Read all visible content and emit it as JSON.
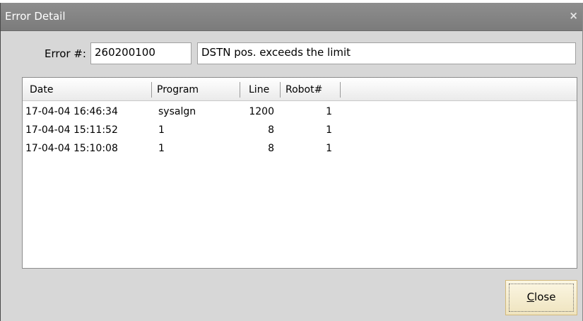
{
  "window": {
    "title": "Error Detail",
    "close_glyph": "×"
  },
  "error": {
    "label": "Error #:",
    "code": "260200100",
    "message": "DSTN pos. exceeds the limit"
  },
  "table": {
    "columns": [
      "Date",
      "Program",
      "Line",
      "Robot#"
    ],
    "rows": [
      {
        "date": "17-04-04 16:46:34",
        "program": "sysalgn",
        "line": "1200",
        "robot": "1"
      },
      {
        "date": "17-04-04 15:11:52",
        "program": "1",
        "line": "8",
        "robot": "1"
      },
      {
        "date": "17-04-04 15:10:08",
        "program": "1",
        "line": "8",
        "robot": "1"
      }
    ]
  },
  "buttons": {
    "close_mnemonic": "C",
    "close_rest": "lose"
  },
  "icons": {
    "title_close": "close-icon"
  },
  "colors": {
    "titlebar": "#8a8a8a",
    "dialog_bg": "#d7d7d7",
    "button_highlight": "#efe4bf"
  }
}
